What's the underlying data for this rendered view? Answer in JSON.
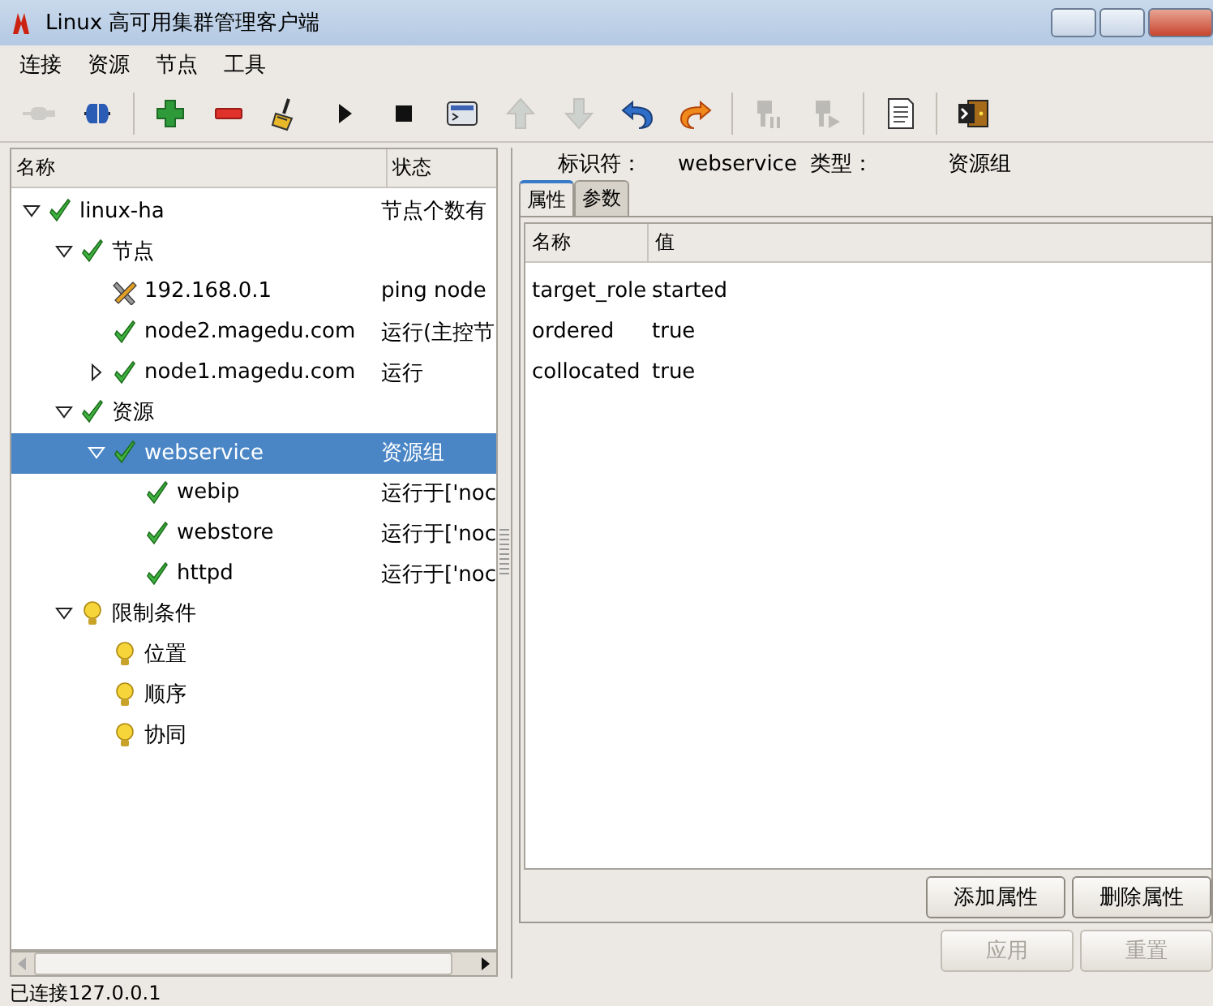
{
  "window": {
    "title": "Linux 高可用集群管理客户端"
  },
  "menu": [
    "连接",
    "资源",
    "节点",
    "工具"
  ],
  "toolbar": [
    {
      "kind": "plug",
      "disabled": true
    },
    {
      "kind": "connect",
      "disabled": false
    },
    {
      "kind": "separator"
    },
    {
      "kind": "add",
      "disabled": false
    },
    {
      "kind": "remove",
      "disabled": false
    },
    {
      "kind": "broom",
      "disabled": false
    },
    {
      "kind": "play",
      "disabled": false
    },
    {
      "kind": "stop",
      "disabled": false
    },
    {
      "kind": "terminal",
      "disabled": false
    },
    {
      "kind": "up",
      "disabled": true
    },
    {
      "kind": "down",
      "disabled": true
    },
    {
      "kind": "undo",
      "disabled": false
    },
    {
      "kind": "redo",
      "disabled": false
    },
    {
      "kind": "separator"
    },
    {
      "kind": "standby",
      "disabled": true
    },
    {
      "kind": "active",
      "disabled": true
    },
    {
      "kind": "separator"
    },
    {
      "kind": "document",
      "disabled": false
    },
    {
      "kind": "separator"
    },
    {
      "kind": "exit",
      "disabled": false
    }
  ],
  "tree": {
    "columns": [
      "名称",
      "状态"
    ],
    "items": [
      {
        "label": "linux-ha",
        "status": "节点个数有",
        "kind": "ok",
        "expanded": true,
        "selected": false,
        "children": [
          {
            "label": "节点",
            "kind": "ok",
            "expanded": true,
            "selected": false,
            "children": [
              {
                "label": "192.168.0.1",
                "status": "ping node",
                "kind": "ping",
                "selected": false
              },
              {
                "label": "node2.magedu.com",
                "status": "运行(主控节",
                "kind": "ok",
                "selected": false
              },
              {
                "label": "node1.magedu.com",
                "status": "运行",
                "kind": "ok",
                "expanded": false,
                "selected": false
              }
            ]
          },
          {
            "label": "资源",
            "kind": "ok",
            "expanded": true,
            "selected": false,
            "children": [
              {
                "label": "webservice",
                "status": "资源组",
                "kind": "ok",
                "expanded": true,
                "selected": true,
                "children": [
                  {
                    "label": "webip",
                    "status": "运行于['noc",
                    "kind": "ok",
                    "selected": false
                  },
                  {
                    "label": "webstore",
                    "status": "运行于['noc",
                    "kind": "ok",
                    "selected": false
                  },
                  {
                    "label": "httpd",
                    "status": "运行于['noc",
                    "kind": "ok",
                    "selected": false
                  }
                ]
              }
            ]
          },
          {
            "label": "限制条件",
            "kind": "constraint",
            "expanded": true,
            "selected": false,
            "children": [
              {
                "label": "位置",
                "kind": "constraint",
                "selected": false
              },
              {
                "label": "顺序",
                "kind": "constraint",
                "selected": false
              },
              {
                "label": "协同",
                "kind": "constraint",
                "selected": false
              }
            ]
          }
        ]
      }
    ]
  },
  "details": {
    "id_label": "标识符：",
    "id_value": "webservice",
    "type_label": "类型：",
    "type_value": "资源组",
    "tabs": [
      {
        "label": "属性",
        "selected": true
      },
      {
        "label": "参数",
        "selected": false
      }
    ],
    "columns": [
      "名称",
      "值"
    ],
    "rows": [
      [
        "target_role",
        "started"
      ],
      [
        "ordered",
        "true"
      ],
      [
        "collocated",
        "true"
      ]
    ],
    "table_buttons": [
      {
        "label": "添加属性",
        "disabled": false
      },
      {
        "label": "删除属性",
        "disabled": false
      }
    ],
    "form_buttons": [
      {
        "label": "应用",
        "disabled": true
      },
      {
        "label": "重置",
        "disabled": true
      }
    ]
  },
  "status_bar": "已连接127.0.0.1"
}
